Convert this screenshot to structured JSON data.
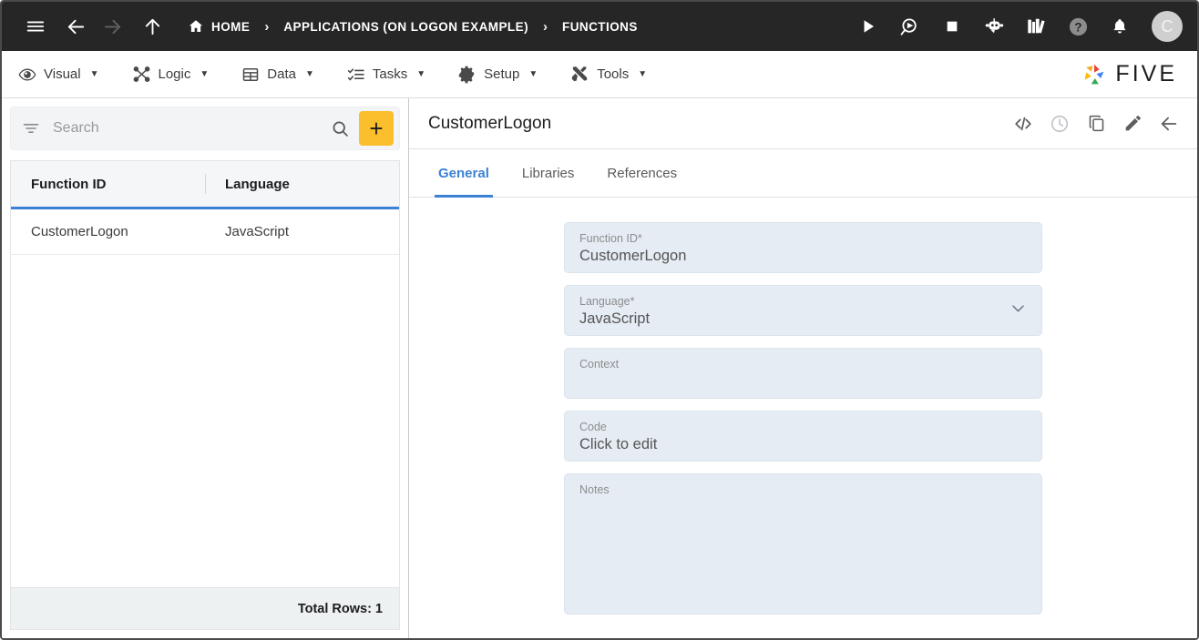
{
  "topbar": {
    "menu_icon": "hamburger-icon",
    "nav": {
      "back": "back-arrow-icon",
      "forward": "forward-arrow-icon",
      "up": "up-arrow-icon"
    },
    "breadcrumbs": [
      {
        "label": "HOME",
        "icon": "home-icon"
      },
      {
        "label": "APPLICATIONS (ON LOGON EXAMPLE)",
        "icon": ""
      },
      {
        "label": "FUNCTIONS",
        "icon": ""
      }
    ],
    "separator": "›",
    "actions": [
      {
        "name": "run-icon",
        "title": "Run"
      },
      {
        "name": "debug-icon",
        "title": "Debug"
      },
      {
        "name": "stop-icon",
        "title": "Stop"
      },
      {
        "name": "chatbot-icon",
        "title": "Chatbot"
      },
      {
        "name": "library-icon",
        "title": "Library"
      },
      {
        "name": "help-icon",
        "title": "Help"
      },
      {
        "name": "notifications-bell-icon",
        "title": "Notifications"
      }
    ],
    "avatar_initial": "C"
  },
  "menubar": {
    "items": [
      {
        "label": "Visual",
        "icon": "eye-icon"
      },
      {
        "label": "Logic",
        "icon": "logic-nodes-icon"
      },
      {
        "label": "Data",
        "icon": "table-grid-icon"
      },
      {
        "label": "Tasks",
        "icon": "task-list-icon"
      },
      {
        "label": "Setup",
        "icon": "gear-icon"
      },
      {
        "label": "Tools",
        "icon": "tools-wrench-icon"
      }
    ],
    "caret": "▼",
    "logo_text": "FIVE"
  },
  "sidebar": {
    "search": {
      "placeholder": "Search",
      "value": "",
      "filter_icon": "filter-icon",
      "search_icon": "search-icon"
    },
    "add_button_label": "+",
    "grid": {
      "columns": [
        "Function ID",
        "Language"
      ],
      "rows": [
        {
          "function_id": "CustomerLogon",
          "language": "JavaScript"
        }
      ]
    },
    "footer": {
      "total_rows_label": "Total Rows: 1"
    }
  },
  "detail": {
    "title": "CustomerLogon",
    "header_icons": [
      {
        "name": "code-icon",
        "disabled": false
      },
      {
        "name": "history-clock-icon",
        "disabled": true
      },
      {
        "name": "duplicate-copy-icon",
        "disabled": false
      },
      {
        "name": "edit-pencil-icon",
        "disabled": false
      },
      {
        "name": "back-arrow-icon",
        "disabled": false
      }
    ],
    "tabs": [
      {
        "label": "General",
        "active": true
      },
      {
        "label": "Libraries",
        "active": false
      },
      {
        "label": "References",
        "active": false
      }
    ],
    "fields": {
      "function_id": {
        "label": "Function ID",
        "required": "*",
        "value": "CustomerLogon"
      },
      "language": {
        "label": "Language",
        "required": "*",
        "value": "JavaScript"
      },
      "context": {
        "label": "Context",
        "value": ""
      },
      "code": {
        "label": "Code",
        "value": "Click to edit"
      },
      "notes": {
        "label": "Notes",
        "value": ""
      }
    }
  },
  "colors": {
    "topbar_bg": "#262626",
    "accent_yellow": "#f9b826",
    "accent_blue": "#3b82d6",
    "field_bg": "#e5ecf4",
    "add_button": "#fbbe2c"
  }
}
